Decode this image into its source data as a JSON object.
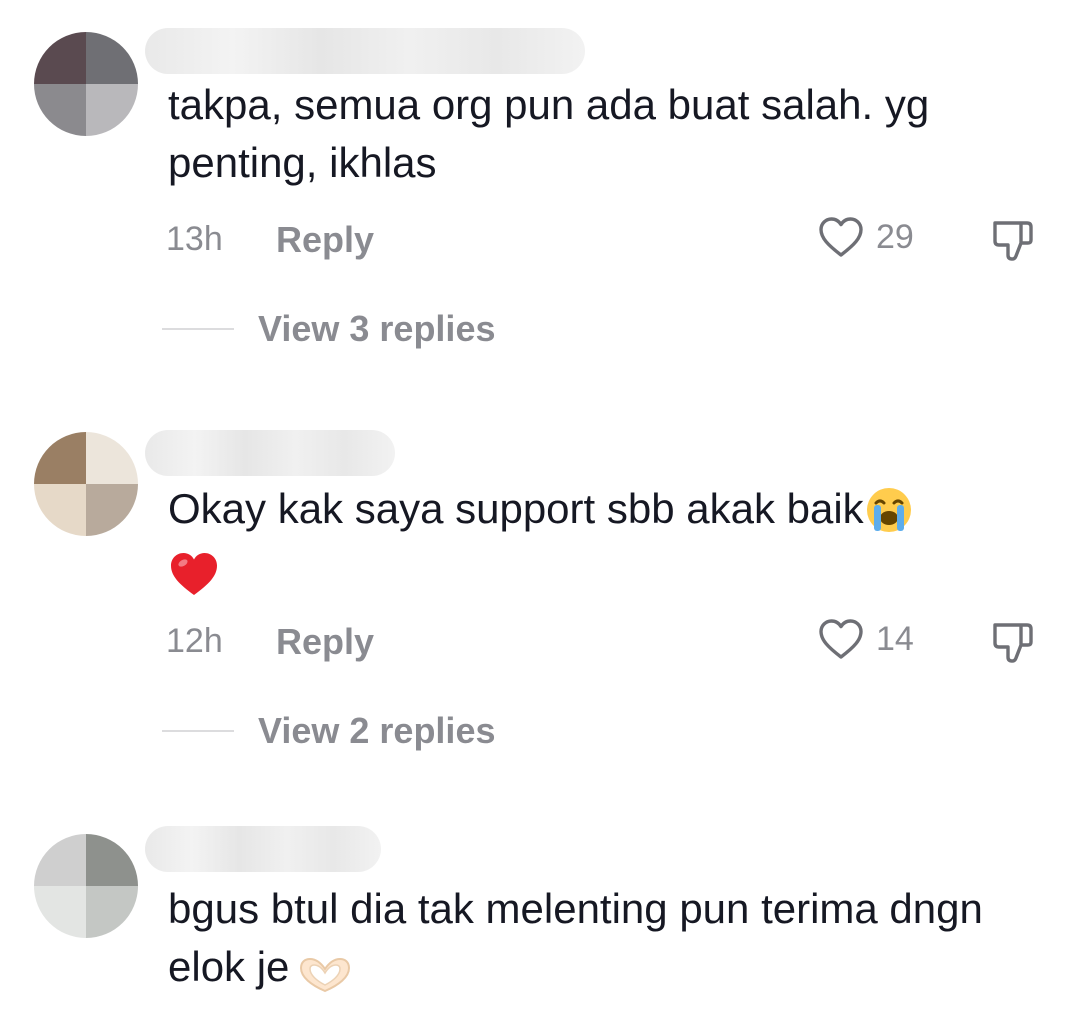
{
  "comments": [
    {
      "text": "takpa, semua org pun ada buat salah. yg penting, ikhlas",
      "time": "13h",
      "reply_label": "Reply",
      "likes": "29",
      "view_replies": "View 3 replies"
    },
    {
      "text": "Okay kak saya support sbb akak baik",
      "time": "12h",
      "reply_label": "Reply",
      "likes": "14",
      "view_replies": "View 2 replies"
    },
    {
      "text": "bgus btul dia tak melenting pun terima dngn elok je"
    }
  ],
  "icons": {
    "like": "heart-outline-icon",
    "dislike": "thumbs-down-icon",
    "emoji_1": "loudly-crying-face-emoji",
    "emoji_2": "red-heart-emoji",
    "emoji_3": "heart-hands-emoji"
  },
  "colors": {
    "text": "#161823",
    "secondary": "#8a8b91",
    "heart_red": "#e8202b"
  }
}
